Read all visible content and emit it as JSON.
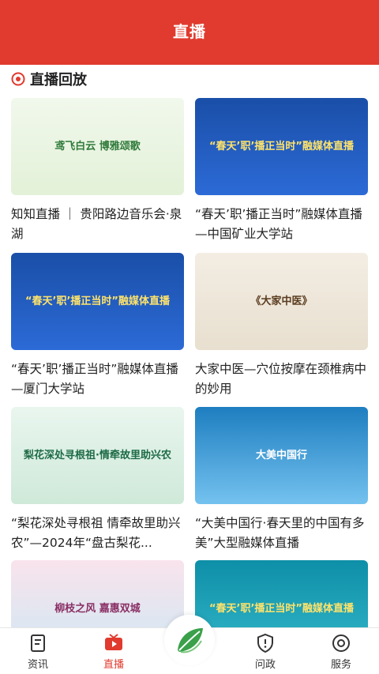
{
  "header": {
    "title": "直播"
  },
  "section": {
    "title": "直播回放"
  },
  "cards": [
    {
      "title": "知知直播 ｜ 贵阳路边音乐会·泉湖",
      "thumb_text": "鸢飞白云 博雅颂歌"
    },
    {
      "title": "“春天’职’播正当时”融媒体直播—中国矿业大学站",
      "thumb_text": "“春天’职’播正当时”融媒体直播"
    },
    {
      "title": "“春天’职’播正当时”融媒体直播—厦门大学站",
      "thumb_text": "“春天’职’播正当时”融媒体直播"
    },
    {
      "title": "大家中医—穴位按摩在颈椎病中的妙用",
      "thumb_text": "《大家中医》"
    },
    {
      "title": "“梨花深处寻根祖 情牵故里助兴农”—2024年“盘古梨花...",
      "thumb_text": "梨花深处寻根祖·情牵故里助兴农"
    },
    {
      "title": "“大美中国行·春天里的中国有多美”大型融媒体直播",
      "thumb_text": "大美中国行"
    },
    {
      "title": "",
      "thumb_text": "柳枝之风 嘉惠双城"
    },
    {
      "title": "",
      "thumb_text": "“春天’职’播正当时”融媒体直播"
    }
  ],
  "tabbar": {
    "items": [
      {
        "label": "资讯",
        "icon": "news-icon",
        "active": false
      },
      {
        "label": "直播",
        "icon": "live-tv-icon",
        "active": true
      },
      {
        "label": "",
        "icon": "leaf-logo-icon",
        "active": false
      },
      {
        "label": "问政",
        "icon": "shield-icon",
        "active": false
      },
      {
        "label": "服务",
        "icon": "service-icon",
        "active": false
      }
    ]
  },
  "colors": {
    "brand": "#e03b2e",
    "text": "#222222"
  }
}
